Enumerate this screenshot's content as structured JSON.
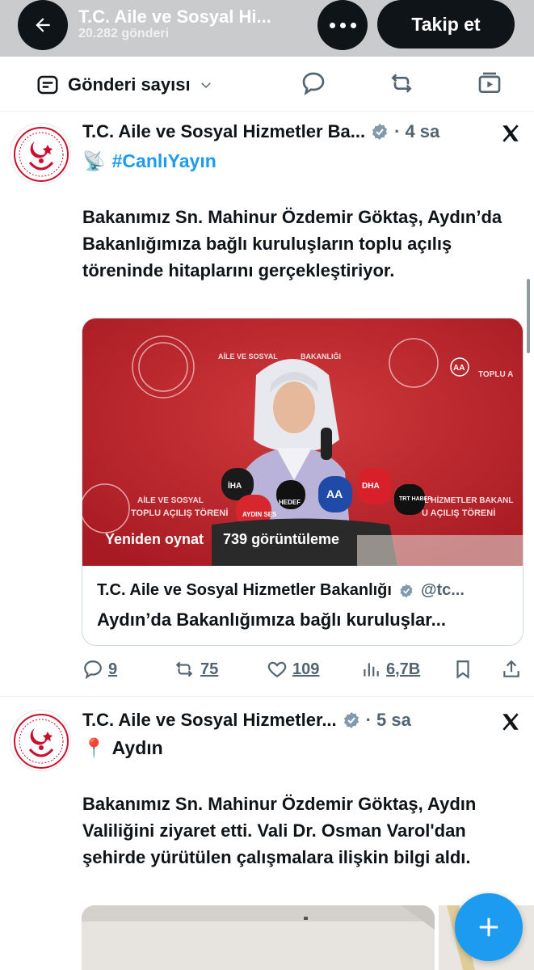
{
  "header": {
    "title": "T.C. Aile ve Sosyal Hi...",
    "post_count": "20.282 gönderi",
    "follow_label": "Takip et"
  },
  "tabs": {
    "sort_label": "Gönderi sayısı"
  },
  "tweets": [
    {
      "author": "T.C. Aile ve Sosyal Hizmetler Ba...",
      "time": "4 sa",
      "line2_emoji": "📡",
      "hashtag": "#CanlıYayın",
      "text": "Bakanımız Sn. Mahinur Özdemir Göktaş, Aydın’da Bakanlığımıza bağlı kuruluşların toplu açılış töreninde hitaplarını gerçekleştiriyor.",
      "video": {
        "replay_label": "Yeniden oynat",
        "views_label": "739 görüntüleme",
        "backdrop_texts": [
          "AİLE VE SOSYAL",
          "BAKANLIĞI",
          "TOPLU A",
          "AİLE VE SOSYAL",
          "TOPLU AÇILIŞ TÖRENİ",
          "TAL HİZMETLER BAKANL",
          "U AÇILIŞ TÖRENİ"
        ],
        "mic_labels": [
          "İHA",
          "HEDEF",
          "AA",
          "DHA",
          "TRT HABER",
          "AYDIN SES"
        ]
      },
      "quote": {
        "author": "T.C. Aile ve Sosyal Hizmetler Bakanlığı",
        "handle": "@tc...",
        "text": "Aydın’da Bakanlığımıza bağlı kuruluşlar..."
      },
      "actions": {
        "replies": "9",
        "reposts": "75",
        "likes": "109",
        "views": "6,7B"
      }
    },
    {
      "author": "T.C. Aile ve Sosyal Hizmetler...",
      "time": "5 sa",
      "line2_emoji": "📍",
      "location": "Aydın",
      "text": "Bakanımız Sn. Mahinur Özdemir Göktaş, Aydın Valiliğini ziyaret etti. Vali Dr. Osman Varol'dan şehirde yürütülen çalışmalara ilişkin bilgi aldı."
    }
  ],
  "colors": {
    "accent": "#1d9bf0",
    "header_bg": "#c9cbcd",
    "video_bg": "#b5232c",
    "muted": "#536471"
  }
}
